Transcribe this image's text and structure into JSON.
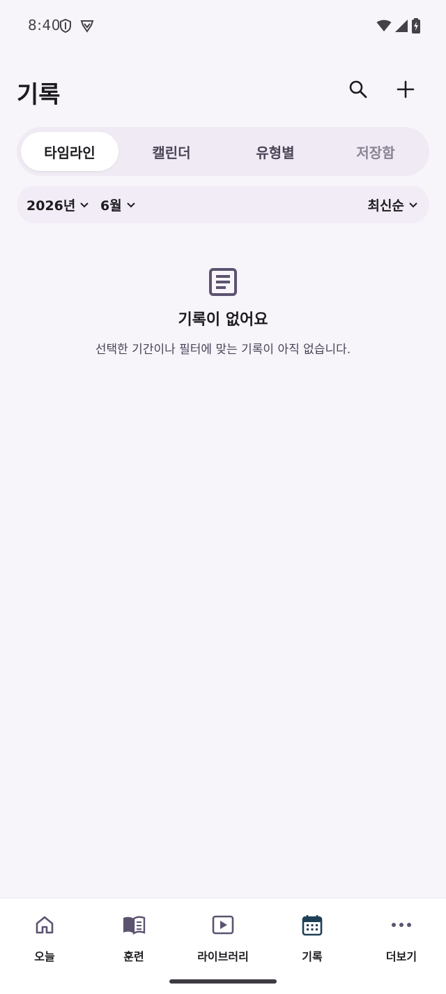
{
  "status_bar": {
    "time": "8:40",
    "icons": [
      "shield-icon",
      "vpn-icon",
      "wifi-icon",
      "signal-icon",
      "battery-charging-icon"
    ]
  },
  "header": {
    "title": "기록",
    "actions": [
      "search-icon",
      "add-icon"
    ]
  },
  "tabs": [
    {
      "label": "타임라인",
      "selected": true
    },
    {
      "label": "캘린더",
      "selected": false
    },
    {
      "label": "유형별",
      "selected": false
    },
    {
      "label": "저장함",
      "selected": false
    }
  ],
  "filters": {
    "year": "2026년",
    "month": "6월",
    "sort": "최신순"
  },
  "empty_state": {
    "icon": "document-icon",
    "title": "기록이 없어요",
    "description": "선택한 기간이나 필터에 맞는 기록이 아직 없습니다."
  },
  "bottom_nav": [
    {
      "label": "오늘",
      "icon": "home-icon",
      "active": false
    },
    {
      "label": "훈련",
      "icon": "book-icon",
      "active": false
    },
    {
      "label": "라이브러리",
      "icon": "play-icon",
      "active": false
    },
    {
      "label": "기록",
      "icon": "calendar-icon",
      "active": true
    },
    {
      "label": "더보기",
      "icon": "more-icon",
      "active": false
    }
  ],
  "colors": {
    "background": "#f8f5fa",
    "accent": "#1f3f57",
    "icon_muted": "#5c5370"
  }
}
